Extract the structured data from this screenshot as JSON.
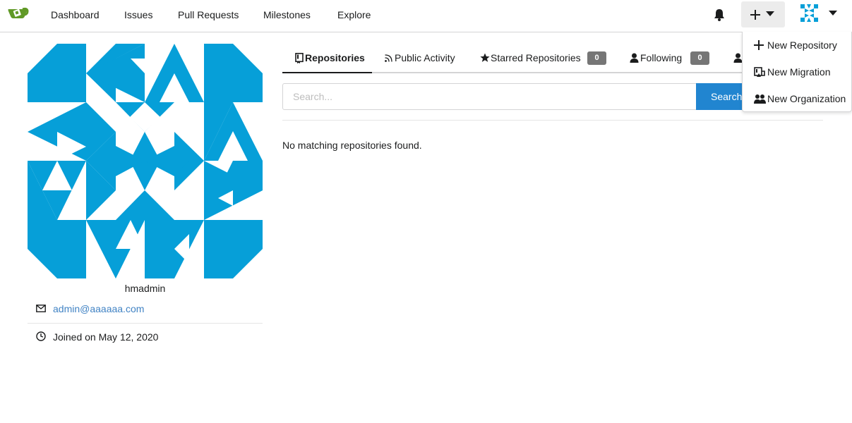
{
  "nav": {
    "items": [
      "Dashboard",
      "Issues",
      "Pull Requests",
      "Milestones",
      "Explore"
    ]
  },
  "create_menu": {
    "items": [
      {
        "label": "New Repository",
        "icon": "plus-icon"
      },
      {
        "label": "New Migration",
        "icon": "repo-push-icon"
      },
      {
        "label": "New Organization",
        "icon": "organization-icon"
      }
    ]
  },
  "profile": {
    "username": "hmadmin",
    "email": "admin@aaaaaa.com",
    "joined": "Joined on May 12, 2020"
  },
  "tabs": [
    {
      "label": "Repositories",
      "icon": "repo-icon",
      "active": true
    },
    {
      "label": "Public Activity",
      "icon": "rss-icon"
    },
    {
      "label": "Starred Repositories",
      "icon": "star-icon",
      "count": "0"
    },
    {
      "label": "Following",
      "icon": "person-icon",
      "count": "0"
    }
  ],
  "search": {
    "placeholder": "Search...",
    "button_label": "Search"
  },
  "empty_message": "No matching repositories found.",
  "colors": {
    "accent": "#2185d0",
    "avatar_blue": "#069fd8",
    "logo_green": "#609926",
    "badge_gray": "#767676"
  }
}
